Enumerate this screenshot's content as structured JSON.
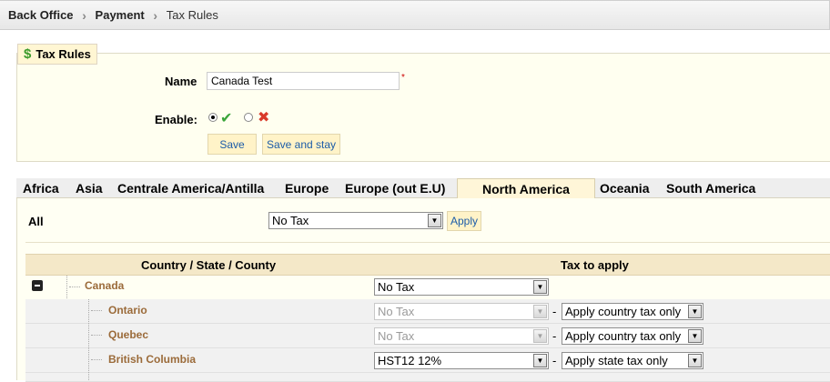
{
  "breadcrumb": {
    "items": [
      "Back Office",
      "Payment",
      "Tax Rules"
    ]
  },
  "form": {
    "legend": "Tax Rules",
    "legend_icon": "dollar-icon",
    "name_label": "Name",
    "name_value": "Canada Test",
    "required_mark": "*",
    "enable_label": "Enable:",
    "enable_value": "enabled",
    "save_label": "Save",
    "save_stay_label": "Save and stay"
  },
  "tabs": {
    "items": [
      "Africa",
      "Asia",
      "Centrale America/Antilla",
      "Europe",
      "Europe (out E.U)",
      "North America",
      "Oceania",
      "South America"
    ],
    "active": "North America"
  },
  "all_row": {
    "label": "All",
    "select_value": "No Tax",
    "apply_label": "Apply"
  },
  "table": {
    "col_country": "Country / State / County",
    "col_tax": "Tax to apply",
    "country": {
      "name": "Canada",
      "tax": "No Tax"
    },
    "states": [
      {
        "name": "Ontario",
        "tax": "No Tax",
        "tax_disabled": true,
        "mode": "Apply country tax only"
      },
      {
        "name": "Quebec",
        "tax": "No Tax",
        "tax_disabled": true,
        "mode": "Apply country tax only"
      },
      {
        "name": "British Columbia",
        "tax": "HST12 12%",
        "tax_disabled": false,
        "mode": "Apply state tax only"
      }
    ],
    "separator": "-"
  },
  "colors": {
    "accent_link": "#1c5ca8",
    "country_text": "#9b6b3a",
    "button_bg": "#fff3c8",
    "header_bg": "#f4e8c8"
  }
}
